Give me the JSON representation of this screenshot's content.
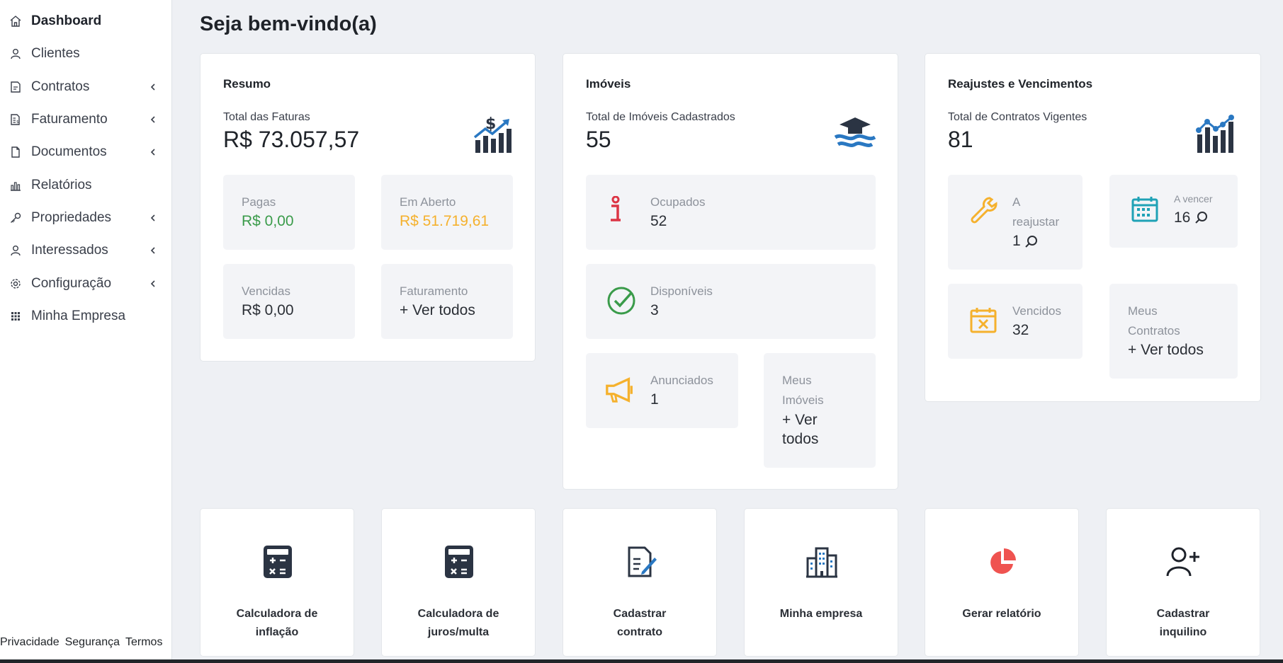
{
  "sidebar": {
    "items": [
      {
        "label": "Dashboard",
        "icon": "home-icon",
        "active": true
      },
      {
        "label": "Clientes",
        "icon": "user-icon"
      },
      {
        "label": "Contratos",
        "icon": "contract-icon",
        "has_submenu": true
      },
      {
        "label": "Faturamento",
        "icon": "invoice-icon",
        "has_submenu": true
      },
      {
        "label": "Documentos",
        "icon": "document-icon",
        "has_submenu": true
      },
      {
        "label": "Relatórios",
        "icon": "bar-chart-icon"
      },
      {
        "label": "Propriedades",
        "icon": "key-icon",
        "has_submenu": true
      },
      {
        "label": "Interessados",
        "icon": "user-icon",
        "has_submenu": true
      },
      {
        "label": "Configuração",
        "icon": "gear-icon",
        "has_submenu": true
      },
      {
        "label": "Minha Empresa",
        "icon": "grid-icon"
      }
    ],
    "footer": [
      "Privacidade",
      "Segurança",
      "Termos"
    ]
  },
  "page_title": "Seja bem-vindo(a)",
  "resumo": {
    "title": "Resumo",
    "total_label": "Total das Faturas",
    "total_value": "R$ 73.057,57",
    "icon": "money-growth-icon",
    "tiles": {
      "pagas": {
        "label": "Pagas",
        "value": "R$ 0,00"
      },
      "em_aberto": {
        "label": "Em Aberto",
        "value": "R$ 51.719,61"
      },
      "vencidas": {
        "label": "Vencidas",
        "value": "R$ 0,00"
      },
      "faturamento": {
        "label": "Faturamento",
        "value": "+ Ver todos"
      }
    }
  },
  "imoveis": {
    "title": "Imóveis",
    "total_label": "Total de Imóveis Cadastrados",
    "total_value": "55",
    "icon": "house-waves-icon",
    "tiles": {
      "ocupados": {
        "label": "Ocupados",
        "value": "52",
        "icon": "info-icon"
      },
      "disponiveis": {
        "label": "Disponíveis",
        "value": "3",
        "icon": "check-circle-icon"
      },
      "anunciados": {
        "label": "Anunciados",
        "value": "1",
        "icon": "megaphone-icon"
      },
      "meus": {
        "label_line1": "Meus",
        "label_line2": "Imóveis",
        "value_line1": "+ Ver",
        "value_line2": "todos"
      }
    }
  },
  "reajustes": {
    "title": "Reajustes e Vencimentos",
    "total_label": "Total de Contratos Vigentes",
    "total_value": "81",
    "icon": "line-bar-chart-icon",
    "tiles": {
      "a_reajustar": {
        "label_line1": "A",
        "label_line2": "reajustar",
        "value": "1",
        "icon": "wrench-icon"
      },
      "a_vencer": {
        "label": "A vencer",
        "value": "16",
        "icon": "calendar-icon"
      },
      "vencidos": {
        "label": "Vencidos",
        "value": "32",
        "icon": "calendar-x-icon"
      },
      "meus": {
        "label_line1": "Meus",
        "label_line2": "Contratos",
        "value": "+ Ver todos"
      }
    }
  },
  "quick_actions": [
    {
      "label_line1": "Calculadora de",
      "label_line2": "inflação",
      "icon": "calculator-icon"
    },
    {
      "label_line1": "Calculadora de",
      "label_line2": "juros/multa",
      "icon": "calculator-icon"
    },
    {
      "label_line1": "Cadastrar",
      "label_line2": "contrato",
      "icon": "contract-sign-icon"
    },
    {
      "label_line1": "Minha empresa",
      "label_line2": "",
      "icon": "building-icon"
    },
    {
      "label_line1": "Gerar relatório",
      "label_line2": "",
      "icon": "pie-chart-icon"
    },
    {
      "label_line1": "Cadastrar",
      "label_line2": "inquilino",
      "icon": "add-user-icon"
    }
  ],
  "colors": {
    "green": "#3a9b4a",
    "orange": "#f5b12d",
    "red": "#dc3545",
    "blue": "#2a78c2",
    "teal": "#1fa2b6",
    "dark": "#2b3443"
  }
}
